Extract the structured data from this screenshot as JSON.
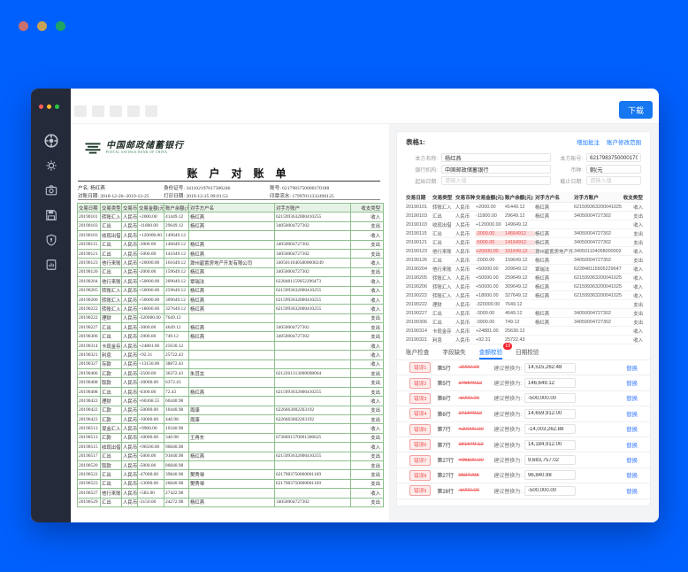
{
  "colors": {
    "background": "#0060fe",
    "accent": "#1677ff",
    "error": "#f5222d",
    "doc_border_green": "#8fbf8f",
    "sidebar": "#252a3b"
  },
  "window": {
    "toolbar": {
      "download_label": "下载"
    }
  },
  "sidebar": {
    "icons": [
      {
        "name": "app-logo-icon"
      },
      {
        "name": "settings-icon"
      },
      {
        "name": "camera-icon"
      },
      {
        "name": "save-icon"
      },
      {
        "name": "shield-icon"
      },
      {
        "name": "report-icon"
      }
    ]
  },
  "document": {
    "bank_name": "中国邮政储蓄银行",
    "bank_caption": "POSTAL SAVINGS BANK OF CHINA",
    "title": "账 户 对 账 单",
    "info_fields": [
      {
        "label": "户名:",
        "value": "杨红燕"
      },
      {
        "label": "身份证号:",
        "value": "341102197617306246"
      },
      {
        "label": "账号:",
        "value": "6217983750000170188"
      },
      {
        "label": "对账日期:",
        "value": "2018-12-26~2019-12-25"
      },
      {
        "label": "打印日期:",
        "value": "2019-12-25 09:01:53"
      },
      {
        "label": "印章流水:",
        "value": "17997011332496125"
      }
    ],
    "table": {
      "headers": [
        "交易日期",
        "交易类型",
        "交易币种",
        "交易金额(元)",
        "账户余额(元)",
        "对手方户名",
        "对手方账户",
        "收支类型"
      ],
      "rows": [
        [
          "20190101",
          "转账汇入",
          "人民币",
          "+2000.00",
          "41449.12",
          "杨红燕",
          "6215993632000410255",
          "收入"
        ],
        [
          "20190103",
          "汇出",
          "人民币",
          "-11800.00",
          "29649.12",
          "杨红燕",
          "34050004727302",
          "支出"
        ],
        [
          "20190103",
          "收现出借",
          "人民币",
          "+120000.00",
          "149649.12",
          "",
          "",
          "收入"
        ],
        [
          "20190115",
          "汇出",
          "人民币",
          "-3000.00",
          "146649.12",
          "杨红燕",
          "34050004727302",
          "支出"
        ],
        [
          "20190121",
          "汇出",
          "人民币",
          "-5000.00",
          "141649.12",
          "杨红燕",
          "34050004727302",
          "支出"
        ],
        [
          "20190123",
          "他行来账",
          "人民币",
          "+20000.00",
          "161649.12",
          "滁州碧置房地产开发有限公司",
          "34050110405800000249",
          "收入"
        ],
        [
          "20190126",
          "汇出",
          "人民币",
          "-2000.00",
          "159649.12",
          "杨红燕",
          "34050004727302",
          "支出"
        ],
        [
          "20190204",
          "他行来账",
          "人民币",
          "+50000.00",
          "209649.12",
          "覃瑞法",
          "6228481159052296473",
          "收入"
        ],
        [
          "20190205",
          "转账汇入",
          "人民币",
          "+50000.00",
          "259649.12",
          "杨红燕",
          "6215993632000410255",
          "收入"
        ],
        [
          "20190206",
          "转账汇入",
          "人民币",
          "+50000.00",
          "309649.12",
          "杨红燕",
          "6215993632000410255",
          "收入"
        ],
        [
          "20190222",
          "转账汇入",
          "人民币",
          "+18000.00",
          "327649.12",
          "杨红燕",
          "6215993632000410255",
          "收入"
        ],
        [
          "20190222",
          "理财",
          "人民币",
          "-320000.00",
          "7649.12",
          "",
          "",
          "支出"
        ],
        [
          "20190227",
          "汇出",
          "人民币",
          "-3000.00",
          "4649.12",
          "杨红燕",
          "34050004727302",
          "支出"
        ],
        [
          "20190306",
          "汇出",
          "人民币",
          "-3900.00",
          "749.12",
          "杨红燕",
          "34050004727302",
          "支出"
        ],
        [
          "20190314",
          "卡现金存",
          "人民币",
          "+24881.00",
          "25630.12",
          "",
          "",
          "收入"
        ],
        [
          "20190321",
          "利息",
          "人民币",
          "+92.31",
          "25722.43",
          "",
          "",
          "收入"
        ],
        [
          "20190327",
          "存款",
          "人民币",
          "+13150.00",
          "38872.43",
          "",
          "",
          "收入"
        ],
        [
          "20190406",
          "汇款",
          "人民币",
          "-2500.00",
          "36372.43",
          "朱其龙",
          "6212261313000098064",
          "支出"
        ],
        [
          "20190408",
          "取款",
          "人民币",
          "-30000.00",
          "6372.43",
          "",
          "",
          "支出"
        ],
        [
          "20190408",
          "汇出",
          "人民币",
          "-6300.00",
          "72.43",
          "杨红燕",
          "6215993632000410255",
          "支出"
        ],
        [
          "20190422",
          "理财",
          "人民币",
          "+60368.55",
          "60440.98",
          "",
          "",
          "收入"
        ],
        [
          "20190422",
          "汇款",
          "人民币",
          "-50000.00",
          "10440.98",
          "周康",
          "6226663002263192",
          "支出"
        ],
        [
          "20190423",
          "汇款",
          "人民币",
          "-10000.00",
          "440.98",
          "周康",
          "6226663002263192",
          "支出"
        ],
        [
          "20190513",
          "现金汇入",
          "人民币",
          "+9900.00",
          "10340.98",
          "",
          "",
          "收入"
        ],
        [
          "20190513",
          "汇款",
          "人民币",
          "-10000.00",
          "340.98",
          "王再东",
          "6736691370001306625",
          "支出"
        ],
        [
          "20190515",
          "收现出借",
          "人民币",
          "+96500.00",
          "96840.98",
          "",
          "",
          "收入"
        ],
        [
          "20190517",
          "汇出",
          "人民币",
          "-5000.00",
          "91840.98",
          "杨红燕",
          "6215993632000410255",
          "支出"
        ],
        [
          "20190520",
          "取款",
          "人民币",
          "-5000.00",
          "86840.98",
          "",
          "",
          "支出"
        ],
        [
          "20190522",
          "汇出",
          "人民币",
          "-47000.00",
          "39840.98",
          "樊秀琴",
          "6217983750000001169",
          "支出"
        ],
        [
          "20190523",
          "汇出",
          "人民币",
          "-13000.00",
          "26840.98",
          "樊秀琴",
          "6217983750000001169",
          "支出"
        ],
        [
          "20190527",
          "他行来账",
          "人民币",
          "+582.00",
          "27422.98",
          "",
          "",
          "收入"
        ],
        [
          "20190529",
          "汇出",
          "人民币",
          "-3150.00",
          "24272.98",
          "杨红燕",
          "34050004727302",
          "支出"
        ]
      ]
    }
  },
  "panel": {
    "card_title": "表格1:",
    "links": [
      {
        "label": "增加批注"
      },
      {
        "label": "账户修改范围"
      }
    ],
    "form": {
      "fields": [
        {
          "label": "本方名称:",
          "value": "杨红燕",
          "placeholder": ""
        },
        {
          "label": "本方账号:",
          "value": "6217983750000170188",
          "placeholder": ""
        },
        {
          "label": "银行机构:",
          "value": "中国邮政储蓄银行",
          "placeholder": ""
        },
        {
          "label": "币种:",
          "value": "朝(元",
          "placeholder": ""
        },
        {
          "label": "起始日期:",
          "value": "",
          "placeholder": "请输入值"
        },
        {
          "label": "截止日期:",
          "value": "",
          "placeholder": "请输入值"
        }
      ]
    },
    "table": {
      "headers": [
        "交易日期",
        "交易类型",
        "交易币种",
        "交易金额(元)",
        "账户余额(元)",
        "对手方户名",
        "对手方账户",
        "收支类型"
      ],
      "rows": [
        {
          "cells": [
            "20190101",
            "转账汇入",
            "人民币",
            "+2000.00",
            "41449.12",
            "杨红燕",
            "6215993632000410255",
            "收入"
          ],
          "hl": []
        },
        {
          "cells": [
            "20190103",
            "汇出",
            "人民币",
            "-11800.00",
            "29649.12",
            "杨红燕",
            "34050004727302",
            "支出"
          ],
          "hl": []
        },
        {
          "cells": [
            "20190103",
            "收现出借",
            "人民币",
            "+120000.00",
            "149649.12",
            "",
            "",
            "收入"
          ],
          "hl": []
        },
        {
          "cells": [
            "20190115",
            "汇出",
            "人民币",
            "-3000.00",
            "14664912",
            "杨红燕",
            "34050004727302",
            "支出"
          ],
          "hl": [
            3,
            4
          ]
        },
        {
          "cells": [
            "20190121",
            "汇出",
            "人民币",
            "-5000.00",
            "14164912",
            "杨红燕",
            "34050004727302",
            "支出"
          ],
          "hl": [
            3,
            4
          ]
        },
        {
          "cells": [
            "20190123",
            "他行来账",
            "人民币",
            "+20000.00",
            "161649.12",
            "滁州碧置房地产开发有限公司",
            "34050110405800000249",
            "收入"
          ],
          "hl": [
            3,
            4
          ]
        },
        {
          "cells": [
            "20190126",
            "汇出",
            "人民币",
            "-2000.00",
            "159649.12",
            "杨红燕",
            "34050004727302",
            "支出"
          ],
          "hl": []
        },
        {
          "cells": [
            "20190204",
            "他行来账",
            "人民币",
            "+50000.00",
            "209649.12",
            "覃瑞法",
            "6228481159052296473",
            "收入"
          ],
          "hl": []
        },
        {
          "cells": [
            "20190205",
            "转账汇入",
            "人民币",
            "+50000.00",
            "259649.12",
            "杨红燕",
            "6215993632000410255",
            "收入"
          ],
          "hl": []
        },
        {
          "cells": [
            "20190206",
            "转账汇入",
            "人民币",
            "+50000.00",
            "309649.12",
            "杨红燕",
            "6215993632000410255",
            "收入"
          ],
          "hl": []
        },
        {
          "cells": [
            "20190222",
            "转账汇入",
            "人民币",
            "+18000.00",
            "327649.12",
            "杨红燕",
            "6215993632000410255",
            "收入"
          ],
          "hl": []
        },
        {
          "cells": [
            "20190222",
            "理财",
            "人民币",
            "-320000.00",
            "7649.12",
            "",
            "",
            "支出"
          ],
          "hl": []
        },
        {
          "cells": [
            "20190227",
            "汇出",
            "人民币",
            "-3000.00",
            "4649.12",
            "杨红燕",
            "34050004727302",
            "支出"
          ],
          "hl": []
        },
        {
          "cells": [
            "20190306",
            "汇出",
            "人民币",
            "-3900.00",
            "749.12",
            "杨红燕",
            "34050004727302",
            "支出"
          ],
          "hl": []
        },
        {
          "cells": [
            "20190314",
            "卡现金存",
            "人民币",
            "+24881.00",
            "25630.12",
            "",
            "",
            "收入"
          ],
          "hl": []
        },
        {
          "cells": [
            "20190321",
            "利息",
            "人民币",
            "+92.31",
            "25722.43",
            "",
            "",
            "收入"
          ],
          "hl": []
        }
      ]
    },
    "tabs": [
      {
        "label": "账户检查",
        "active": false,
        "badge": ""
      },
      {
        "label": "字段缺失",
        "active": false,
        "badge": ""
      },
      {
        "label": "金额校验",
        "active": true,
        "badge": "19"
      },
      {
        "label": "日期校验",
        "active": false,
        "badge": ""
      }
    ],
    "corrections": {
      "suggest_label": "建议替换为:",
      "replace_label": "替换",
      "items": [
        {
          "tag": "错误1",
          "row": "第5行",
          "old": "-3000.00",
          "suggestion": "14,515,262.48"
        },
        {
          "tag": "错误2",
          "row": "第5行",
          "old": "14664912",
          "suggestion": "146,649.12"
        },
        {
          "tag": "错误3",
          "row": "第6行",
          "old": "-5000.00",
          "suggestion": "-500,000.00"
        },
        {
          "tag": "错误4",
          "row": "第6行",
          "old": "14164912",
          "suggestion": "14,659,912.00"
        },
        {
          "tag": "错误5",
          "row": "第7行",
          "old": "+20000.00",
          "suggestion": "-14,003,262.88"
        },
        {
          "tag": "错误6",
          "row": "第7行",
          "old": "161649.12",
          "suggestion": "14,184,912.00"
        },
        {
          "tag": "错误7",
          "row": "第27行",
          "old": "+96500.00",
          "suggestion": "9,683,757.02"
        },
        {
          "tag": "错误8",
          "row": "第27行",
          "old": "9684098",
          "suggestion": "96,840.98"
        },
        {
          "tag": "错误9",
          "row": "第28行",
          "old": "-5000.00",
          "suggestion": "-500,000.00"
        }
      ]
    }
  }
}
